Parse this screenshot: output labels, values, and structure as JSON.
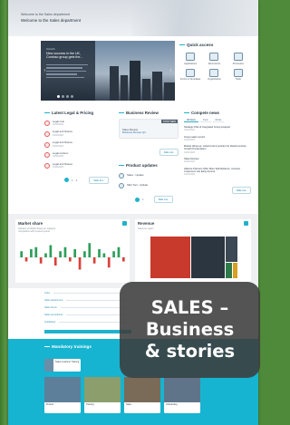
{
  "hero": {
    "breadcrumb": "Welcome to the Sales department",
    "title": "Welcome to the Sales department"
  },
  "carousel": {
    "tag": "SALES",
    "headline": "New success in the UK, Contoso group gets the..."
  },
  "quick_access": {
    "title": "Quick access",
    "items": [
      "Applications",
      "Documents",
      "Processes",
      "Forms & Templates",
      "Organization",
      "Tools"
    ]
  },
  "legal": {
    "title": "Latest Legal & Pricing",
    "items": [
      {
        "title": "Legal note",
        "date": "01/02/2023"
      },
      {
        "title": "Legal and finance",
        "date": "01/02/2023"
      },
      {
        "title": "Legal and finance",
        "date": "01/02/2023"
      },
      {
        "title": "Legal revision",
        "date": "01/02/2023"
      },
      {
        "title": "Legal and finance",
        "date": "01/02/2023"
      }
    ],
    "page_a": "1",
    "page_b": "2",
    "see_all": "SEE ALL"
  },
  "business_review": {
    "title": "Business Review",
    "badge": "POST NEW",
    "line1": "Sales Review",
    "line2": "Business Review Q1",
    "see_all": "SEE ALL"
  },
  "product_updates": {
    "title": "Product updates",
    "items": [
      "Sales - Update",
      "SEC Tool - Update"
    ],
    "see_all": "SEE ALL"
  },
  "news": {
    "title": "Compete news",
    "tabs": [
      "All News",
      "Tools",
      "Rivals"
    ],
    "items": [
      {
        "text": "Strategic Plan & Integrated Group Analysis",
        "date": "01/02/2023"
      },
      {
        "text": "Group sales record",
        "date": "01/02/2023"
      },
      {
        "text": "Market Wrap-up: Listed fund & position for Retail Contoso Growth Presentation",
        "date": "01/02/2023"
      },
      {
        "text": "Sales Review",
        "date": "01/02/2023"
      },
      {
        "text": "Alliance Partners Offer More Self-Reliance, Contoso Customers Get Early Access",
        "date": "01/02/2023"
      }
    ],
    "see_all": "SEE ALL"
  },
  "market_share": {
    "title": "Market share",
    "subtitle": "Variation of Market Share per Category",
    "note": "Comparison with previous period"
  },
  "revenue": {
    "title": "Revenue",
    "legend": "Sales per region"
  },
  "links": {
    "items": [
      "Links",
      "Sales department",
      "Sales forms",
      "Sales procedures",
      "Guidelines"
    ]
  },
  "training": {
    "title": "Mandatory trainings",
    "items": [
      "Sales Customer Training",
      "Product",
      "Training",
      "Sales",
      "Onboarding"
    ]
  },
  "overlay": {
    "line1": "SALES –",
    "line2": "Business",
    "line3": "& stories"
  },
  "chart_data": {
    "type": "bar",
    "title": "Market share",
    "categories": [
      "1",
      "2",
      "3",
      "4",
      "5",
      "6",
      "7",
      "8",
      "9",
      "10",
      "11",
      "12",
      "13",
      "14",
      "15",
      "16",
      "17",
      "18",
      "19",
      "20",
      "21",
      "22"
    ],
    "series": [
      {
        "values": [
          3,
          -2,
          4,
          5,
          -3,
          2,
          6,
          -4,
          3,
          5,
          -2,
          4,
          -6,
          3,
          7,
          -3,
          4,
          2,
          -5,
          3,
          5,
          -2
        ]
      }
    ],
    "ylim": [
      -8,
      8
    ],
    "colors": [
      "#2e9e5a",
      "#d9413a"
    ]
  }
}
